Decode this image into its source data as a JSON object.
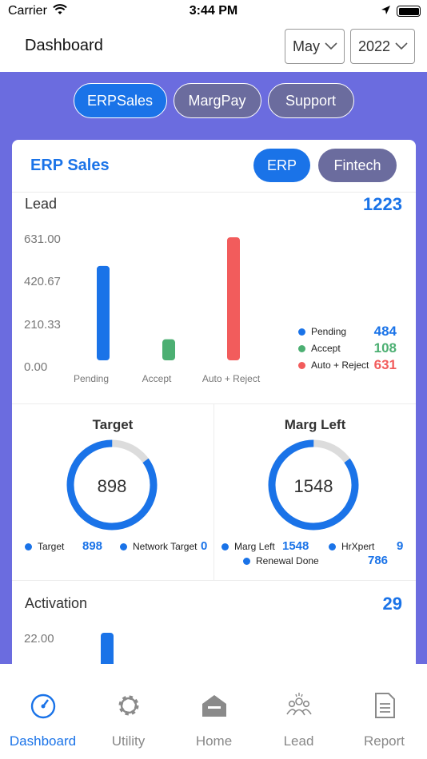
{
  "status_bar": {
    "carrier": "Carrier",
    "time": "3:44 PM"
  },
  "header": {
    "title": "Dashboard",
    "month": "May",
    "year": "2022"
  },
  "tabs": [
    {
      "label": "ERPSales",
      "active": true
    },
    {
      "label": "MargPay",
      "active": false
    },
    {
      "label": "Support",
      "active": false
    }
  ],
  "card": {
    "title": "ERP Sales",
    "toggles": [
      {
        "label": "ERP",
        "active": true
      },
      {
        "label": "Fintech",
        "active": false
      }
    ]
  },
  "lead": {
    "label": "Lead",
    "total": "1223",
    "legend": [
      {
        "label": "Pending",
        "value": "484",
        "color": "#1a73e8"
      },
      {
        "label": "Accept",
        "value": "108",
        "color": "#4caf72"
      },
      {
        "label": "Auto + Reject",
        "value": "631",
        "color": "#f25c5c"
      }
    ]
  },
  "chart_data": [
    {
      "type": "bar",
      "categories": [
        "Pending",
        "Accept",
        "Auto + Reject"
      ],
      "values": [
        484,
        108,
        631
      ],
      "colors": [
        "#1a73e8",
        "#4caf72",
        "#f25c5c"
      ],
      "yticks": [
        "631.00",
        "420.67",
        "210.33",
        "0.00"
      ],
      "ylim": [
        0,
        631
      ]
    },
    {
      "type": "bar",
      "categories": [
        ""
      ],
      "values": [
        22
      ],
      "colors": [
        "#1a73e8"
      ],
      "yticks": [
        "22.00"
      ],
      "ylim": [
        0,
        22
      ]
    }
  ],
  "target": {
    "title": "Target",
    "center": "898",
    "progress": 0.85,
    "legend": [
      {
        "label": "Target",
        "value": "898"
      },
      {
        "label": "Network Target",
        "value": "0"
      }
    ]
  },
  "marg_left": {
    "title": "Marg Left",
    "center": "1548",
    "progress": 0.85,
    "legend": [
      {
        "label": "Marg Left",
        "value": "1548"
      },
      {
        "label": "HrXpert",
        "value": "9"
      },
      {
        "label": "Renewal Done",
        "value": "786"
      }
    ]
  },
  "activation": {
    "label": "Activation",
    "total": "29"
  },
  "colors": {
    "accent": "#1a73e8",
    "background": "#6b6cdf",
    "inactive_pill": "#6b6c9e"
  },
  "bottom_nav": [
    {
      "label": "Dashboard",
      "icon": "speedometer-icon",
      "active": true
    },
    {
      "label": "Utility",
      "icon": "gear-icon",
      "active": false
    },
    {
      "label": "Home",
      "icon": "home-icon",
      "active": false
    },
    {
      "label": "Lead",
      "icon": "group-icon",
      "active": false
    },
    {
      "label": "Report",
      "icon": "document-icon",
      "active": false
    }
  ]
}
